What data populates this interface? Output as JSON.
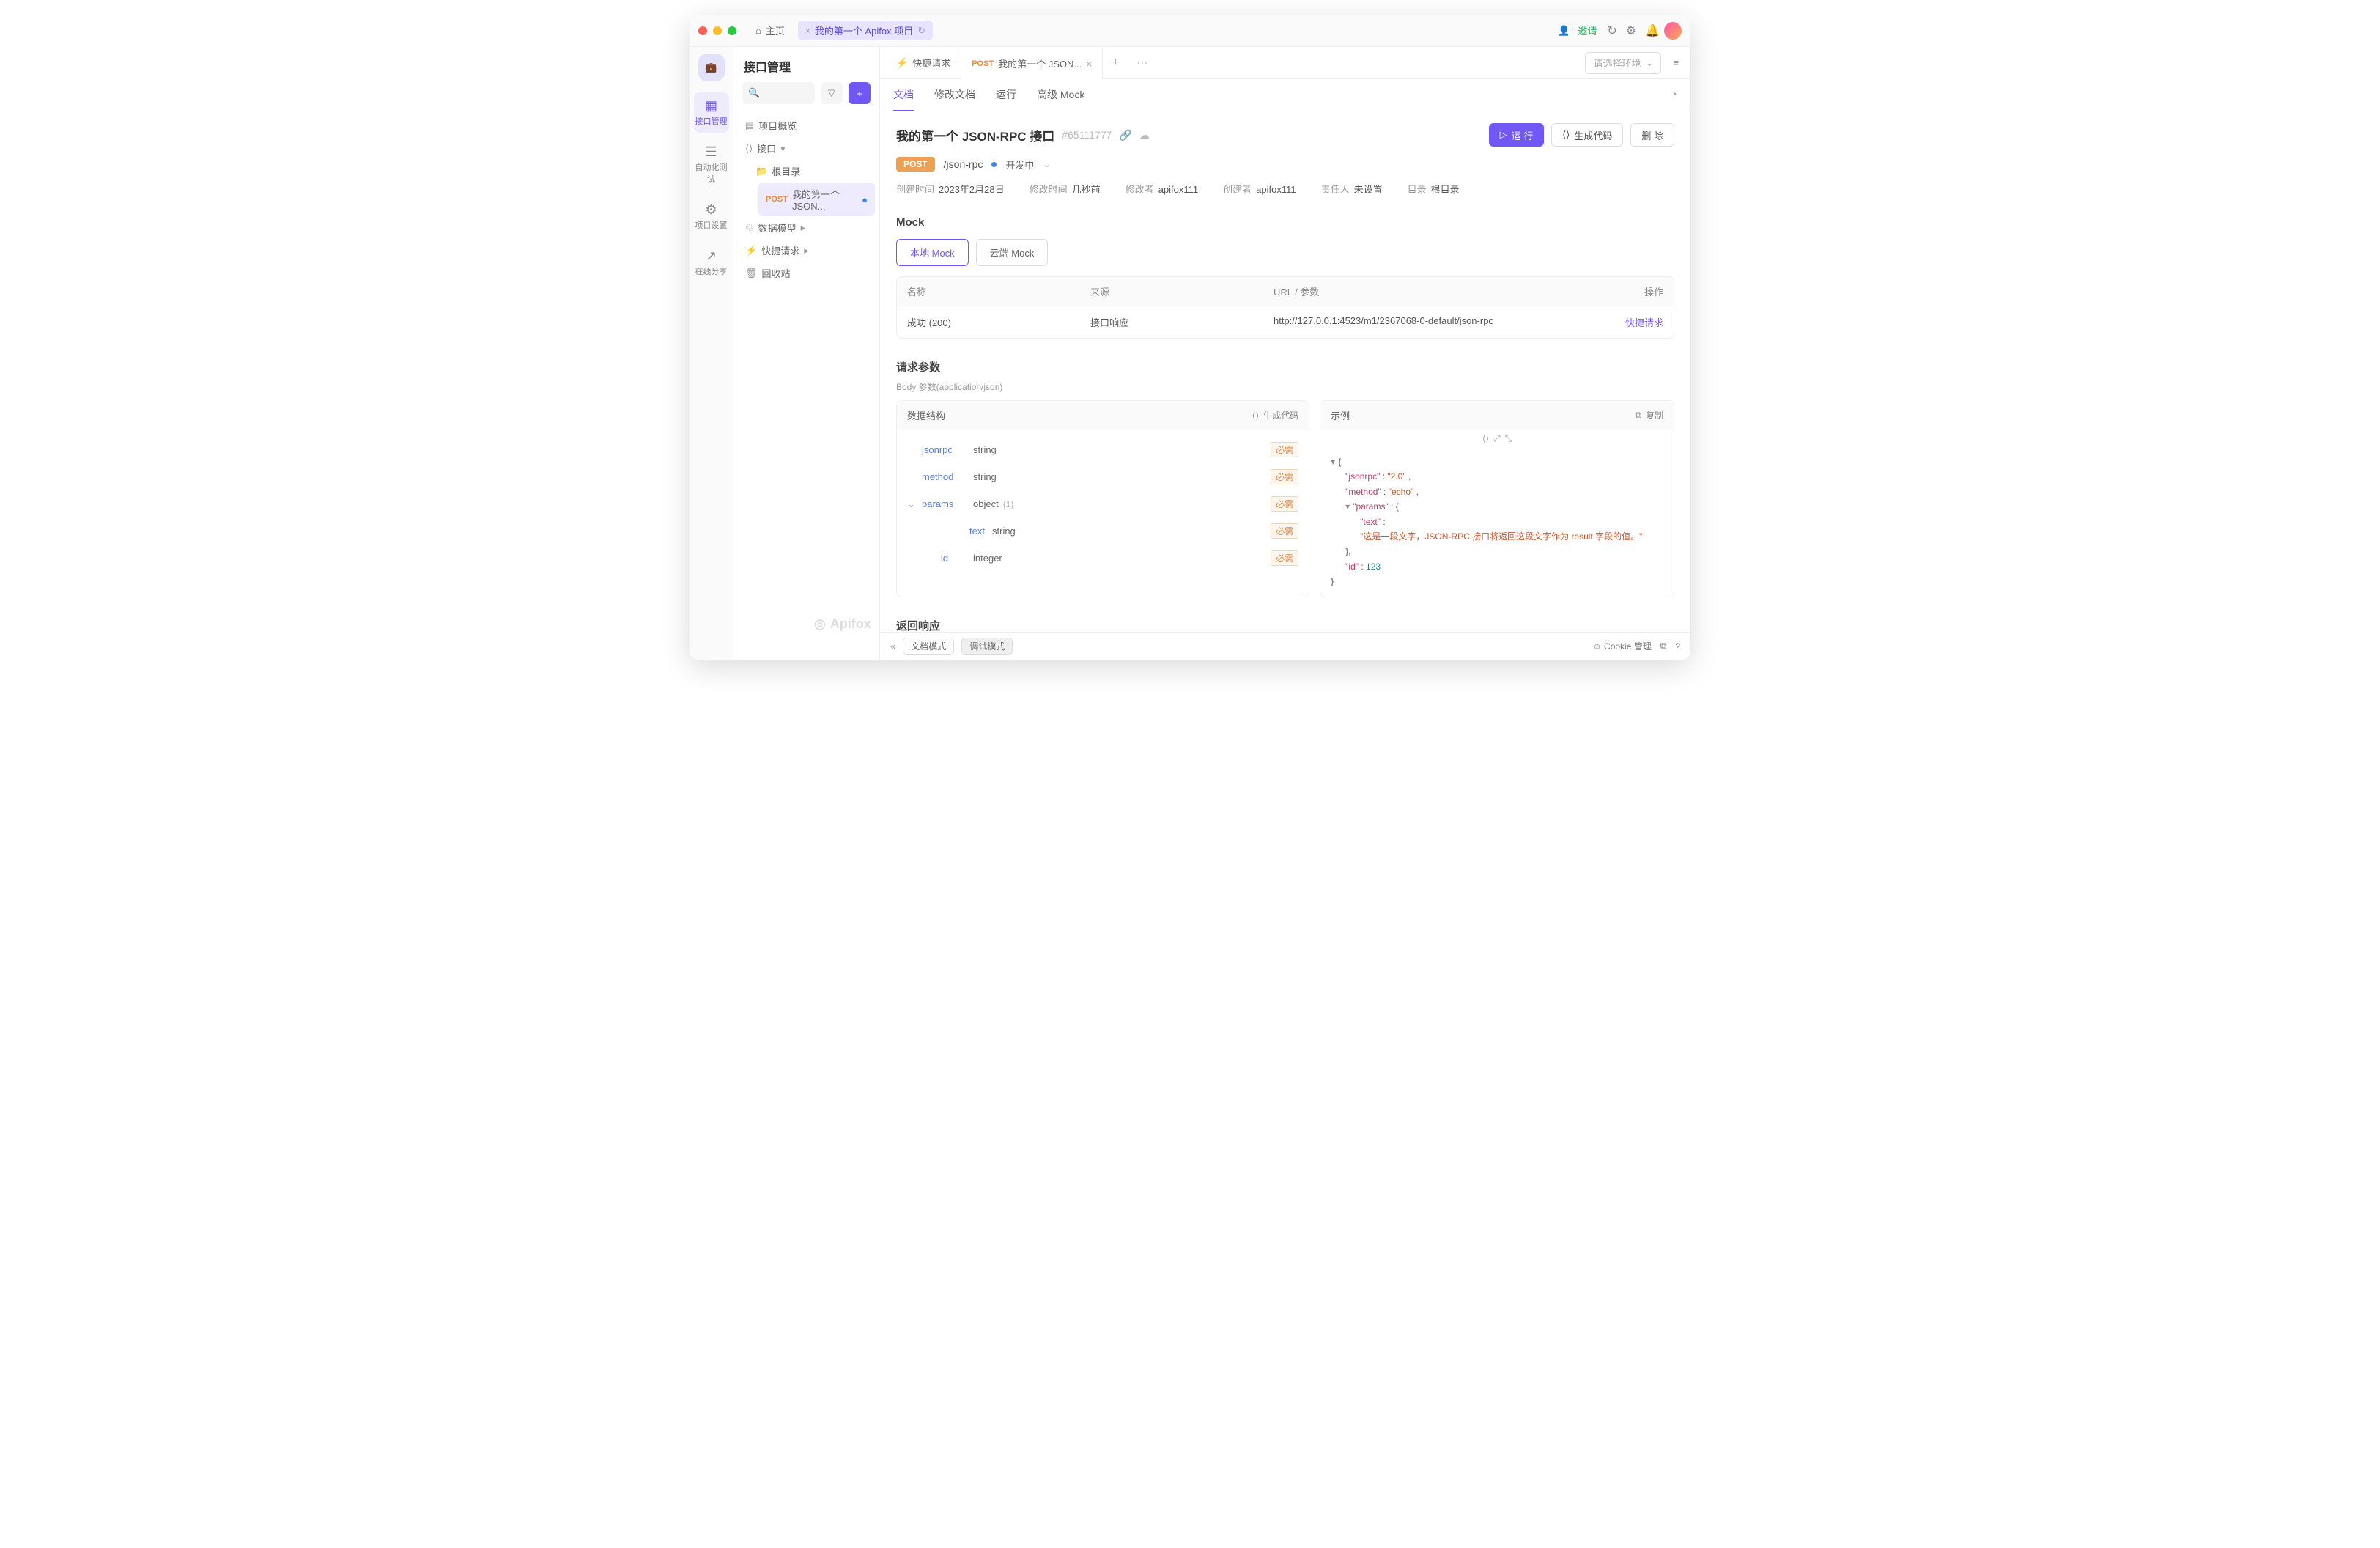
{
  "titlebar": {
    "home": "主页",
    "project_tab": "我的第一个 Apifox 项目",
    "invite": "邀请"
  },
  "sidenav": {
    "items": [
      {
        "label": "接口管理",
        "icon": "📑"
      },
      {
        "label": "自动化测试",
        "icon": "☰"
      },
      {
        "label": "项目设置",
        "icon": "⚙"
      },
      {
        "label": "在线分享",
        "icon": "↗"
      }
    ]
  },
  "panel": {
    "title": "接口管理",
    "search_ph": "",
    "overview": "项目概览",
    "api": "接口",
    "root": "根目录",
    "api_item_method": "POST",
    "api_item_name": "我的第一个 JSON...",
    "data_model": "数据模型",
    "quick": "快捷请求",
    "trash": "回收站"
  },
  "tabs": {
    "quick": "快捷请求",
    "active_method": "POST",
    "active_name": "我的第一个 JSON...",
    "env_ph": "请选择环境"
  },
  "subtabs": [
    "文档",
    "修改文档",
    "运行",
    "高级 Mock"
  ],
  "api": {
    "title": "我的第一个 JSON-RPC 接口",
    "id": "#65111777",
    "run": "运 行",
    "gen_code": "生成代码",
    "delete": "删 除",
    "method": "POST",
    "path": "/json-rpc",
    "status": "开发中",
    "meta": [
      {
        "k": "创建时间",
        "v": "2023年2月28日"
      },
      {
        "k": "修改时间",
        "v": "几秒前"
      },
      {
        "k": "修改者",
        "v": "apifox111"
      },
      {
        "k": "创建者",
        "v": "apifox111"
      },
      {
        "k": "责任人",
        "v": "未设置"
      },
      {
        "k": "目录",
        "v": "根目录"
      }
    ]
  },
  "mock": {
    "title": "Mock",
    "local": "本地 Mock",
    "cloud": "云端 Mock",
    "hdr": {
      "name": "名称",
      "source": "来源",
      "url": "URL / 参数",
      "action": "操作"
    },
    "row": {
      "name": "成功 (200)",
      "source": "接口响应",
      "url": "http://127.0.0.1:4523/m1/2367068-0-default/json-rpc",
      "action": "快捷请求"
    }
  },
  "req": {
    "title": "请求参数",
    "sub": "Body 参数(application/json)",
    "struct_title": "数据结构",
    "gen": "生成代码",
    "example_title": "示例",
    "copy": "复制",
    "required": "必需",
    "fields": [
      {
        "key": "jsonrpc",
        "type": "string"
      },
      {
        "key": "method",
        "type": "string"
      },
      {
        "key": "params",
        "type": "object",
        "ann": "{1}",
        "expand": true
      },
      {
        "key": "text",
        "type": "string",
        "indent": true
      },
      {
        "key": "id",
        "type": "integer"
      }
    ],
    "example": {
      "jsonrpc": "2.0",
      "method": "echo",
      "text": "这是一段文字，JSON-RPC 接口将返回这段文字作为 result 字段的值。",
      "id": "123"
    }
  },
  "resp": {
    "title": "返回响应"
  },
  "footer": {
    "doc_mode": "文档模式",
    "debug_mode": "调试模式",
    "cookie": "Cookie 管理"
  },
  "watermark": "Apifox"
}
